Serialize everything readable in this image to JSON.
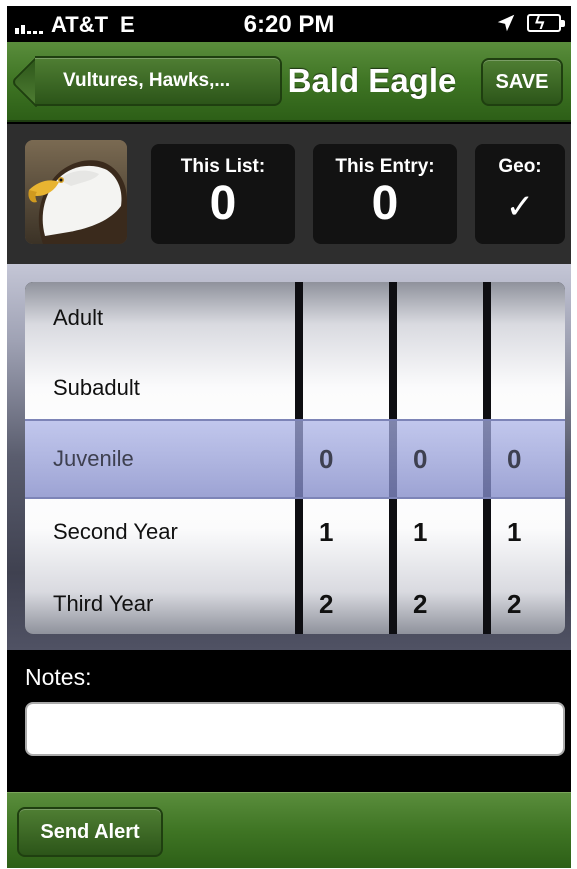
{
  "status_bar": {
    "carrier": "AT&T",
    "network": "E",
    "time": "6:20 PM"
  },
  "nav": {
    "back_label": "Vultures, Hawks,...",
    "title": "Bald Eagle",
    "save_label": "SAVE"
  },
  "stats": {
    "list_label": "This List:",
    "list_value": "0",
    "entry_label": "This Entry:",
    "entry_value": "0",
    "geo_label": "Geo:",
    "geo_value": "✓"
  },
  "picker": {
    "ages": [
      "Adult",
      "Subadult",
      "Juvenile",
      "Second Year",
      "Third Year"
    ],
    "selected_age": "Juvenile",
    "wheels": [
      {
        "selected": "0",
        "below": [
          "1",
          "2"
        ]
      },
      {
        "selected": "0",
        "below": [
          "1",
          "2"
        ]
      },
      {
        "selected": "0",
        "below": [
          "1",
          "2"
        ]
      }
    ]
  },
  "notes": {
    "label": "Notes:",
    "value": ""
  },
  "toolbar": {
    "alert_label": "Send Alert"
  },
  "colors": {
    "nav_green": "#3f7524",
    "selection_blue": "#a8b0e0"
  }
}
